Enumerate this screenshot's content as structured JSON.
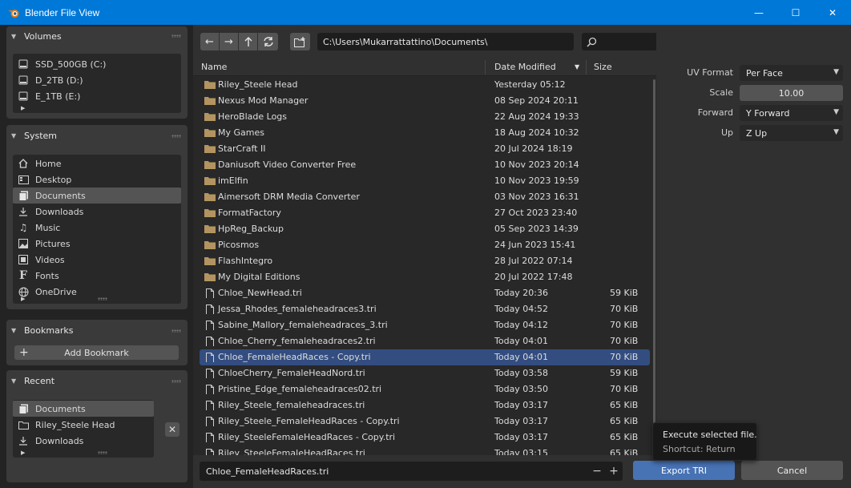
{
  "window": {
    "title": "Blender File View",
    "minimize_glyph": "—",
    "maximize_glyph": "☐",
    "close_glyph": "✕"
  },
  "sidebar": {
    "volumes": {
      "header": "Volumes",
      "items": [
        {
          "label": "SSD_500GB (C:)",
          "icon": "drive-icon"
        },
        {
          "label": "D_2TB (D:)",
          "icon": "drive-icon"
        },
        {
          "label": "E_1TB (E:)",
          "icon": "drive-icon"
        }
      ]
    },
    "system": {
      "header": "System",
      "items": [
        {
          "label": "Home",
          "icon": "home-icon"
        },
        {
          "label": "Desktop",
          "icon": "desktop-icon"
        },
        {
          "label": "Documents",
          "icon": "documents-icon",
          "active": true
        },
        {
          "label": "Downloads",
          "icon": "downloads-icon"
        },
        {
          "label": "Music",
          "icon": "music-icon"
        },
        {
          "label": "Pictures",
          "icon": "pictures-icon"
        },
        {
          "label": "Videos",
          "icon": "videos-icon"
        },
        {
          "label": "Fonts",
          "icon": "fonts-icon"
        },
        {
          "label": "OneDrive",
          "icon": "globe-icon"
        }
      ]
    },
    "bookmarks": {
      "header": "Bookmarks",
      "add_label": "Add Bookmark"
    },
    "recent": {
      "header": "Recent",
      "items": [
        {
          "label": "Documents",
          "icon": "documents-icon",
          "active": true
        },
        {
          "label": "Riley_Steele  Head",
          "icon": "folder-icon"
        },
        {
          "label": "Downloads",
          "icon": "downloads-icon"
        }
      ]
    }
  },
  "toolbar": {
    "path": "C:\\Users\\Mukarrattattino\\Documents\\",
    "search_placeholder": ""
  },
  "columns": {
    "name": "Name",
    "date": "Date Modified",
    "size": "Size"
  },
  "files": [
    {
      "name": "Riley_Steele  Head",
      "date": "Yesterday 05:12",
      "size": "",
      "type": "folder"
    },
    {
      "name": "Nexus Mod Manager",
      "date": "08 Sep 2024 20:11",
      "size": "",
      "type": "folder"
    },
    {
      "name": "HeroBlade Logs",
      "date": "22 Aug 2024 19:33",
      "size": "",
      "type": "folder"
    },
    {
      "name": "My Games",
      "date": "18 Aug 2024 10:32",
      "size": "",
      "type": "folder"
    },
    {
      "name": "StarCraft II",
      "date": "20 Jul 2024 18:19",
      "size": "",
      "type": "folder"
    },
    {
      "name": "Daniusoft Video Converter Free",
      "date": "10 Nov 2023 20:14",
      "size": "",
      "type": "folder"
    },
    {
      "name": "imElfin",
      "date": "10 Nov 2023 19:59",
      "size": "",
      "type": "folder"
    },
    {
      "name": "Aimersoft DRM Media Converter",
      "date": "03 Nov 2023 16:31",
      "size": "",
      "type": "folder"
    },
    {
      "name": "FormatFactory",
      "date": "27 Oct 2023 23:40",
      "size": "",
      "type": "folder"
    },
    {
      "name": "HpReg_Backup",
      "date": "05 Sep 2023 14:39",
      "size": "",
      "type": "folder"
    },
    {
      "name": "Picosmos",
      "date": "24 Jun 2023 15:41",
      "size": "",
      "type": "folder"
    },
    {
      "name": "FlashIntegro",
      "date": "28 Jul 2022 07:14",
      "size": "",
      "type": "folder"
    },
    {
      "name": "My Digital Editions",
      "date": "20 Jul 2022 17:48",
      "size": "",
      "type": "folder"
    },
    {
      "name": "Chloe_NewHead.tri",
      "date": "Today 20:36",
      "size": "59 KiB",
      "type": "file"
    },
    {
      "name": "Jessa_Rhodes_femaleheadraces3.tri",
      "date": "Today 04:52",
      "size": "70 KiB",
      "type": "file"
    },
    {
      "name": "Sabine_Mallory_femaleheadraces_3.tri",
      "date": "Today 04:12",
      "size": "70 KiB",
      "type": "file"
    },
    {
      "name": "Chloe_Cherry_femaleheadraces2.tri",
      "date": "Today 04:01",
      "size": "70 KiB",
      "type": "file"
    },
    {
      "name": "Chloe_FemaleHeadRaces - Copy.tri",
      "date": "Today 04:01",
      "size": "70 KiB",
      "type": "file",
      "selected": true
    },
    {
      "name": "ChloeCherry_FemaleHeadNord.tri",
      "date": "Today 03:58",
      "size": "59 KiB",
      "type": "file"
    },
    {
      "name": "Pristine_Edge_femaleheadraces02.tri",
      "date": "Today 03:50",
      "size": "70 KiB",
      "type": "file"
    },
    {
      "name": "Riley_Steele_femaleheadraces.tri",
      "date": "Today 03:17",
      "size": "65 KiB",
      "type": "file"
    },
    {
      "name": "Riley_Steele_FemaleHeadRaces - Copy.tri",
      "date": "Today 03:17",
      "size": "65 KiB",
      "type": "file"
    },
    {
      "name": "Riley_SteeleFemaleHeadRaces - Copy.tri",
      "date": "Today 03:17",
      "size": "65 KiB",
      "type": "file"
    },
    {
      "name": "Riley_SteeleFemaleHeadRaces.tri",
      "date": "Today 03:15",
      "size": "65 KiB",
      "type": "file"
    }
  ],
  "bottom": {
    "filename": "Chloe_FemaleHeadRaces.tri",
    "minus": "−",
    "plus": "+",
    "execute_label": "Export TRI",
    "cancel_label": "Cancel"
  },
  "properties": {
    "uv_format": {
      "label": "UV Format",
      "value": "Per Face"
    },
    "scale": {
      "label": "Scale",
      "value": "10.00"
    },
    "forward": {
      "label": "Forward",
      "value": "Y Forward"
    },
    "up": {
      "label": "Up",
      "value": "Z Up"
    }
  },
  "tooltip": {
    "line1": "Execute selected file.",
    "line2": "Shortcut: Return"
  },
  "colors": {
    "accent": "#4772b3",
    "titlebar": "#0078d7",
    "selected_row": "#334d80",
    "folder": "#b39461"
  }
}
